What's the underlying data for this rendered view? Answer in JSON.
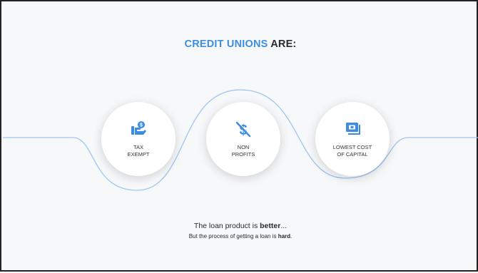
{
  "title": {
    "accent": "CREDIT UNIONS",
    "rest": " ARE:"
  },
  "items": [
    {
      "icon": "hand-money-icon",
      "line1": "TAX",
      "line2": "EXEMPT"
    },
    {
      "icon": "dollar-slash-icon",
      "line1": "NON",
      "line2": "PROFITS"
    },
    {
      "icon": "cash-stack-icon",
      "line1": "LOWEST COST",
      "line2": "OF CAPITAL"
    }
  ],
  "footer": {
    "line1_pre": "The loan product is ",
    "line1_bold": "better",
    "line1_post": "...",
    "line2_pre": "But the process of getting a loan is ",
    "line2_bold": "hard",
    "line2_post": "."
  },
  "colors": {
    "accent": "#3d8de0",
    "wave": "#9ec5f2",
    "border": "#222222"
  }
}
